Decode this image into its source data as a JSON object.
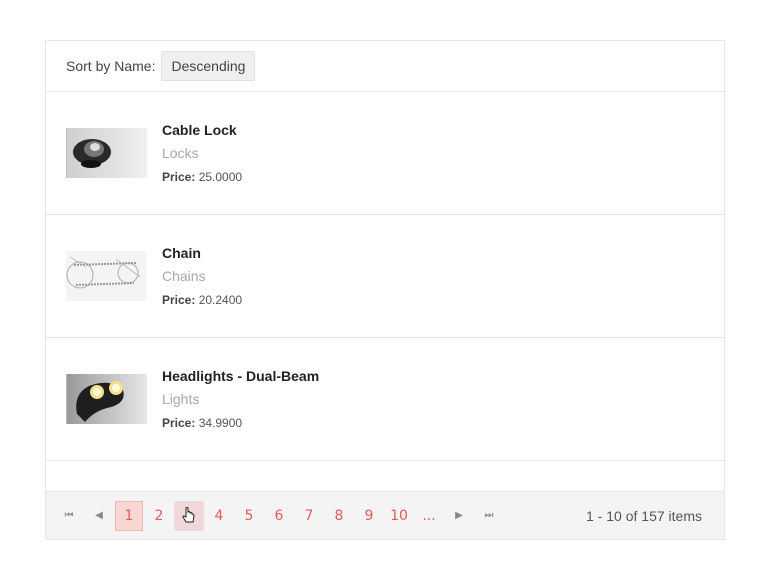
{
  "sort": {
    "label": "Sort by Name:",
    "value": "Descending"
  },
  "products": [
    {
      "name": "Cable Lock",
      "category": "Locks",
      "price_label": "Price:",
      "price": "25.0000",
      "icon": "cable-lock-thumbnail"
    },
    {
      "name": "Chain",
      "category": "Chains",
      "price_label": "Price:",
      "price": "20.2400",
      "icon": "chain-thumbnail"
    },
    {
      "name": "Headlights - Dual-Beam",
      "category": "Lights",
      "price_label": "Price:",
      "price": "34.9900",
      "icon": "headlights-thumbnail"
    }
  ],
  "pager": {
    "first": "⏮",
    "prev": "◀",
    "next": "▶",
    "last": "⏭",
    "pages": [
      "1",
      "2",
      "3",
      "4",
      "5",
      "6",
      "7",
      "8",
      "9",
      "10",
      "..."
    ],
    "current_page": "1",
    "info": "1 - 10 of 157 items"
  },
  "colors": {
    "accent": "#e15c57",
    "current_bg": "#f8d6d4",
    "pager_bg": "#f4f4f4"
  }
}
